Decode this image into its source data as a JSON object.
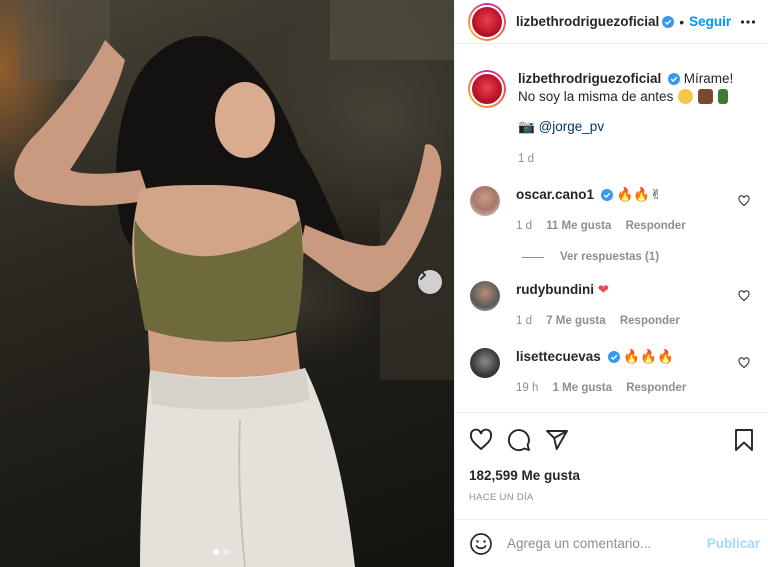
{
  "post": {
    "username": "lizbethrodriguezoficial",
    "separator": "•",
    "follow_label": "Seguir",
    "carousel": {
      "slide": 1,
      "total": 2
    }
  },
  "caption": {
    "username": "lizbethrodriguezoficial",
    "text_line1": "Mírame!",
    "text_line2": "No soy la misma de antes",
    "camera_emoji": "📷",
    "credit": "@jorge_pv",
    "time": "1 d"
  },
  "comments": [
    {
      "username": "oscar.cano1",
      "verified": true,
      "emojis": "🔥🔥✌",
      "time": "1 d",
      "likes": "11 Me gusta",
      "reply": "Responder",
      "view_replies": "Ver respuestas (1)"
    },
    {
      "username": "rudybundini",
      "verified": false,
      "emojis": "❤",
      "time": "1 d",
      "likes": "7 Me gusta",
      "reply": "Responder"
    },
    {
      "username": "lisettecuevas",
      "verified": true,
      "emojis": "🔥🔥🔥",
      "time": "19 h",
      "likes": "1 Me gusta",
      "reply": "Responder"
    }
  ],
  "stats": {
    "likes": "182,599 Me gusta",
    "posted": "HACE UN DÍA"
  },
  "composer": {
    "placeholder": "Agrega un comentario...",
    "publish_label": "Publicar"
  },
  "colors": {
    "accent": "#0095f6",
    "secondary_text": "#8e8e8e",
    "heart": "#ed4956"
  },
  "icons": [
    "more-icon",
    "verified-icon",
    "heart-icon",
    "comment-icon",
    "share-icon",
    "bookmark-icon",
    "smiley-icon",
    "chevron-right-icon"
  ]
}
